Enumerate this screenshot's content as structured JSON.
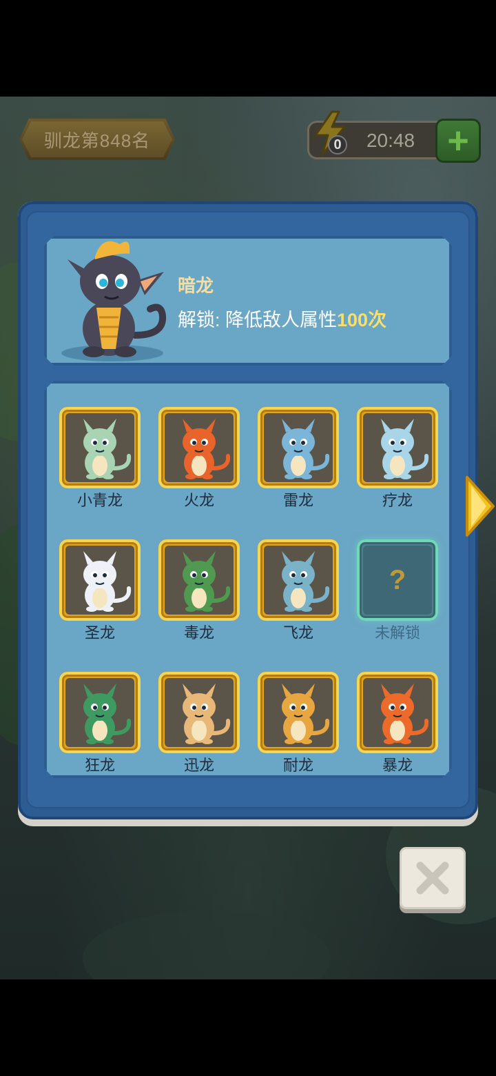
{
  "hud": {
    "rank_label": "驯龙第848名",
    "energy_count": "0",
    "energy_timer": "20:48",
    "add_button_label": "+"
  },
  "selected": {
    "name": "暗龙",
    "unlock_prefix": "解锁: 降低敌人属性",
    "unlock_value": "100次"
  },
  "dragons": [
    {
      "label": "小青龙",
      "color": "#a9d4b4",
      "state": "unlocked"
    },
    {
      "label": "火龙",
      "color": "#e8642a",
      "state": "unlocked"
    },
    {
      "label": "雷龙",
      "color": "#7bb6d8",
      "state": "unlocked"
    },
    {
      "label": "疗龙",
      "color": "#a8d6e8",
      "state": "unlocked"
    },
    {
      "label": "圣龙",
      "color": "#eef2f8",
      "state": "unlocked"
    },
    {
      "label": "毒龙",
      "color": "#4f9a50",
      "state": "unlocked"
    },
    {
      "label": "飞龙",
      "color": "#7ab3c8",
      "state": "unlocked"
    },
    {
      "label": "未解锁",
      "color": "#3f6876",
      "state": "locked"
    },
    {
      "label": "狂龙",
      "color": "#3f9a62",
      "state": "unlocked"
    },
    {
      "label": "迅龙",
      "color": "#e8b878",
      "state": "unlocked"
    },
    {
      "label": "耐龙",
      "color": "#e8a640",
      "state": "unlocked"
    },
    {
      "label": "暴龙",
      "color": "#ec6a2a",
      "state": "unlocked"
    }
  ],
  "locked_symbol": "?",
  "colors": {
    "panel": "#2c5c92",
    "box": "#6aa6c5",
    "gold": "#e3a41c",
    "highlight": "#f8df6b"
  }
}
